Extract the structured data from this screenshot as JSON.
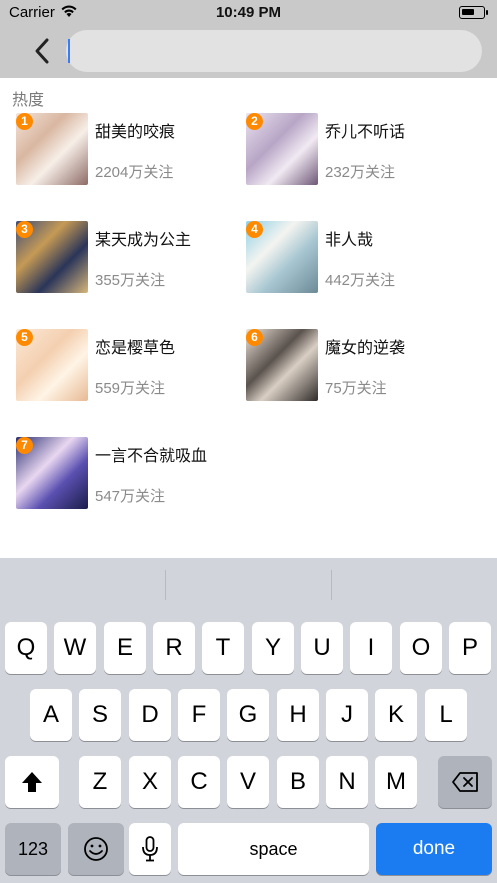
{
  "status": {
    "carrier": "Carrier",
    "time": "10:49 PM"
  },
  "search": {
    "value": ""
  },
  "section": {
    "label": "热度"
  },
  "comics": [
    {
      "rank": "1",
      "name": "甜美的咬痕",
      "follows": "2204万关注"
    },
    {
      "rank": "2",
      "name": "乔儿不听话",
      "follows": "232万关注"
    },
    {
      "rank": "3",
      "name": "某天成为公主",
      "follows": "355万关注"
    },
    {
      "rank": "4",
      "name": "非人哉",
      "follows": "442万关注"
    },
    {
      "rank": "5",
      "name": "恋是樱草色",
      "follows": "559万关注"
    },
    {
      "rank": "6",
      "name": "魔女的逆袭",
      "follows": "75万关注"
    },
    {
      "rank": "7",
      "name": "一言不合就吸血",
      "follows": "547万关注"
    }
  ],
  "keyboard": {
    "row1": [
      "Q",
      "W",
      "E",
      "R",
      "T",
      "Y",
      "U",
      "I",
      "O",
      "P"
    ],
    "row2": [
      "A",
      "S",
      "D",
      "F",
      "G",
      "H",
      "J",
      "K",
      "L"
    ],
    "row3": [
      "Z",
      "X",
      "C",
      "V",
      "B",
      "N",
      "M"
    ],
    "numbers_label": "123",
    "space_label": "space",
    "done_label": "done",
    "icons": {
      "shift": "shift-arrow-icon",
      "delete": "backspace-icon",
      "emoji": "emoji-icon",
      "mic": "microphone-icon"
    }
  },
  "colors": {
    "rank_badge": "#ff8a00",
    "done_key": "#1b7cf2",
    "caret": "#3b7cf5"
  }
}
